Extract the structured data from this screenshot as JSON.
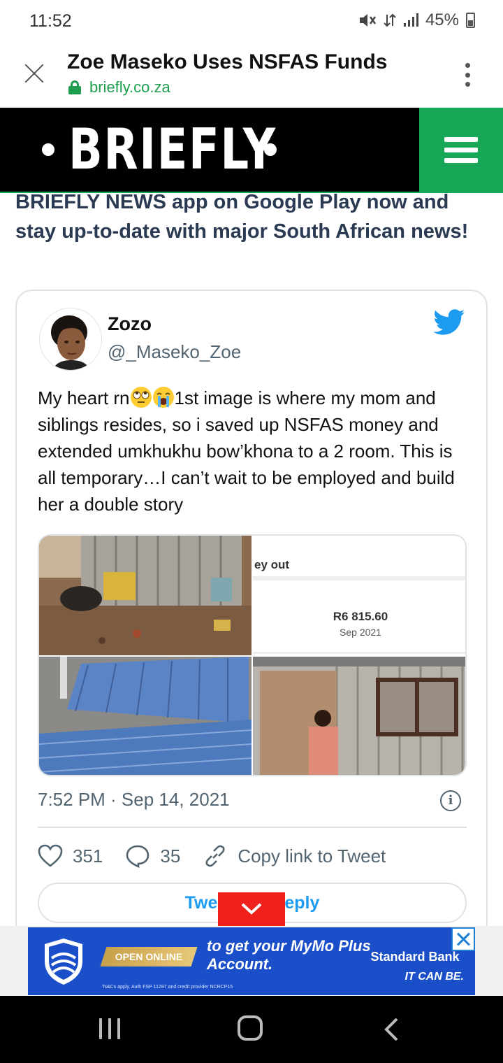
{
  "status_bar": {
    "time": "11:52",
    "icons": [
      "mute-icon",
      "data-arrows-icon",
      "signal-icon",
      "battery-icon"
    ],
    "battery": "45%"
  },
  "tab": {
    "title": "Zoe Maseko Uses NSFAS Funds",
    "url": "briefly.co.za"
  },
  "site": {
    "logo": "BRIEFLY",
    "accent_color": "#17a857"
  },
  "promo_text": "BRIEFLY NEWS app on Google Play now and stay up-to-date with major South African news!",
  "tweet": {
    "name": "Zozo",
    "handle": "@_Maseko_Zoe",
    "text_before": "My heart rn",
    "text_after": "1st image is where my mom and siblings resides, so i saved up NSFAS money and extended umkhukhu bow’khona to a 2 room. This is all temporary…I can’t wait to be employed and build her a double story",
    "emojis": [
      "rolling-eyes-emoji",
      "crying-emoji"
    ],
    "media": {
      "screenshot_title": "ey out",
      "screenshot_amount": "R6 815.60",
      "screenshot_date": "Sep 2021"
    },
    "timestamp": "7:52 PM · Sep 14, 2021",
    "likes": "351",
    "replies": "35",
    "copy_link": "Copy link to Tweet",
    "reply_left": "Twe",
    "reply_right": "eply",
    "brand_color": "#1d9bf0"
  },
  "ad": {
    "cta": "OPEN ONLINE",
    "headline": "to get your MyMo Plus Account.",
    "brand": "Standard Bank",
    "tagline": "IT CAN BE.",
    "fine_print": "Ts&Cs apply. Auth FSP 11287 and credit provider NCRCP15"
  }
}
